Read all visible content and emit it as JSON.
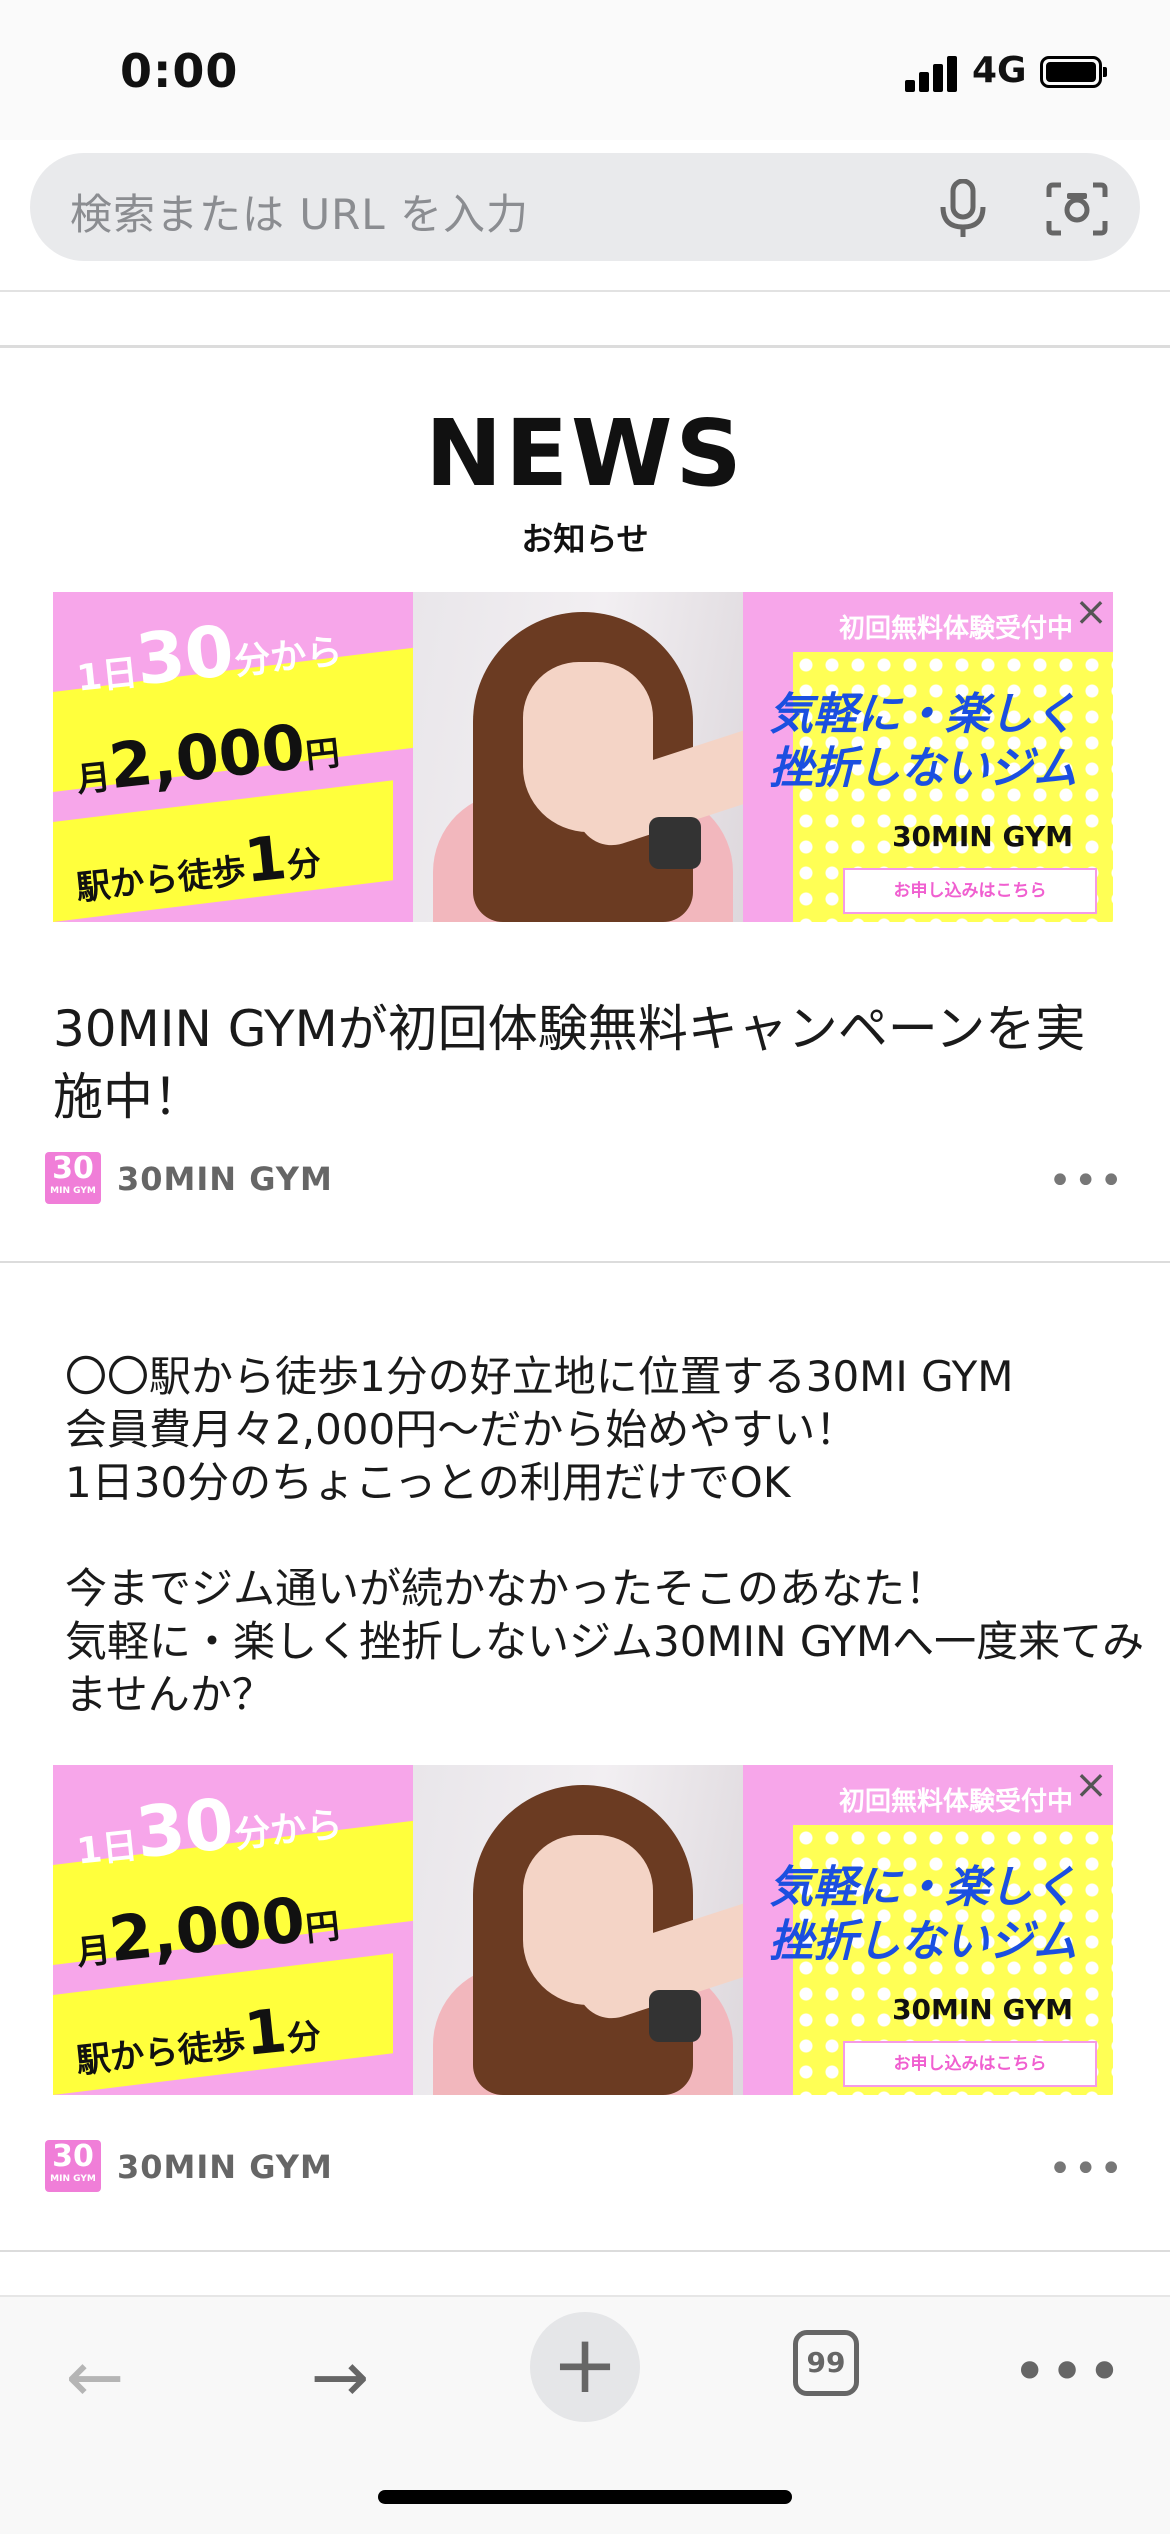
{
  "status_bar": {
    "time": "0:00",
    "network": "4G"
  },
  "url_bar": {
    "placeholder": "検索または URL を入力"
  },
  "news": {
    "title": "NEWS",
    "subtitle": "お知らせ"
  },
  "ad": {
    "line1_pre": "1日",
    "line1_num": "30",
    "line1_post": "分から",
    "line2_pre": "月",
    "line2_num": "2,000",
    "line2_post": "円",
    "line3_pre": "駅から徒歩",
    "line3_num": "1",
    "line3_post": "分",
    "top_label": "初回無料体験受付中",
    "headline_1": "気軽に・楽しく",
    "headline_2": "挫折しないジム",
    "brand": "30MIN GYM",
    "cta": "お申し込みはこちら",
    "close_icon": "×"
  },
  "article": {
    "title": "30MIN GYMが初回体験無料キャンペーンを実施中！",
    "author_logo_big": "30",
    "author_logo_small": "MIN GYM",
    "author": "30MIN GYM",
    "more_icon": "•••",
    "body": [
      "〇〇駅から徒歩1分の好立地に位置する30MI GYM",
      "会員費月々2,000円〜だから始めやすい！",
      "1日30分のちょこっとの利用だけでOK",
      "",
      "今までジム通いが続かなかったそこのあなた！",
      "気軽に・楽しく挫折しないジム30MIN GYMへ一度来てみませんか？"
    ]
  },
  "toolbar": {
    "back_icon": "←",
    "forward_icon": "→",
    "new_tab_icon": "+",
    "tab_count": "99",
    "menu_icon": "•••"
  }
}
